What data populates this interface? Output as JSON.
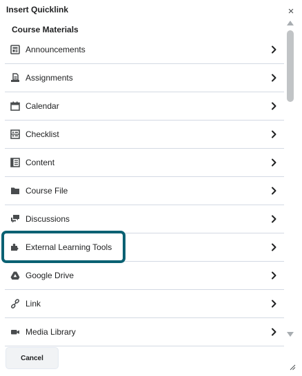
{
  "dialog": {
    "title": "Insert Quicklink",
    "close_glyph": "×"
  },
  "section": {
    "heading": "Course Materials"
  },
  "items": [
    {
      "label": "Announcements",
      "icon": "announcements-icon"
    },
    {
      "label": "Assignments",
      "icon": "assignments-icon"
    },
    {
      "label": "Calendar",
      "icon": "calendar-icon"
    },
    {
      "label": "Checklist",
      "icon": "checklist-icon"
    },
    {
      "label": "Content",
      "icon": "content-icon"
    },
    {
      "label": "Course File",
      "icon": "folder-icon"
    },
    {
      "label": "Discussions",
      "icon": "discussions-icon"
    },
    {
      "label": "External Learning Tools",
      "icon": "puzzle-icon"
    },
    {
      "label": "Google Drive",
      "icon": "google-drive-icon"
    },
    {
      "label": "Link",
      "icon": "link-icon"
    },
    {
      "label": "Media Library",
      "icon": "video-camera-icon"
    }
  ],
  "footer": {
    "cancel_label": "Cancel"
  },
  "colors": {
    "highlight": "#0a6173",
    "divider": "#d3d9e3",
    "icon": "#494c4e"
  }
}
